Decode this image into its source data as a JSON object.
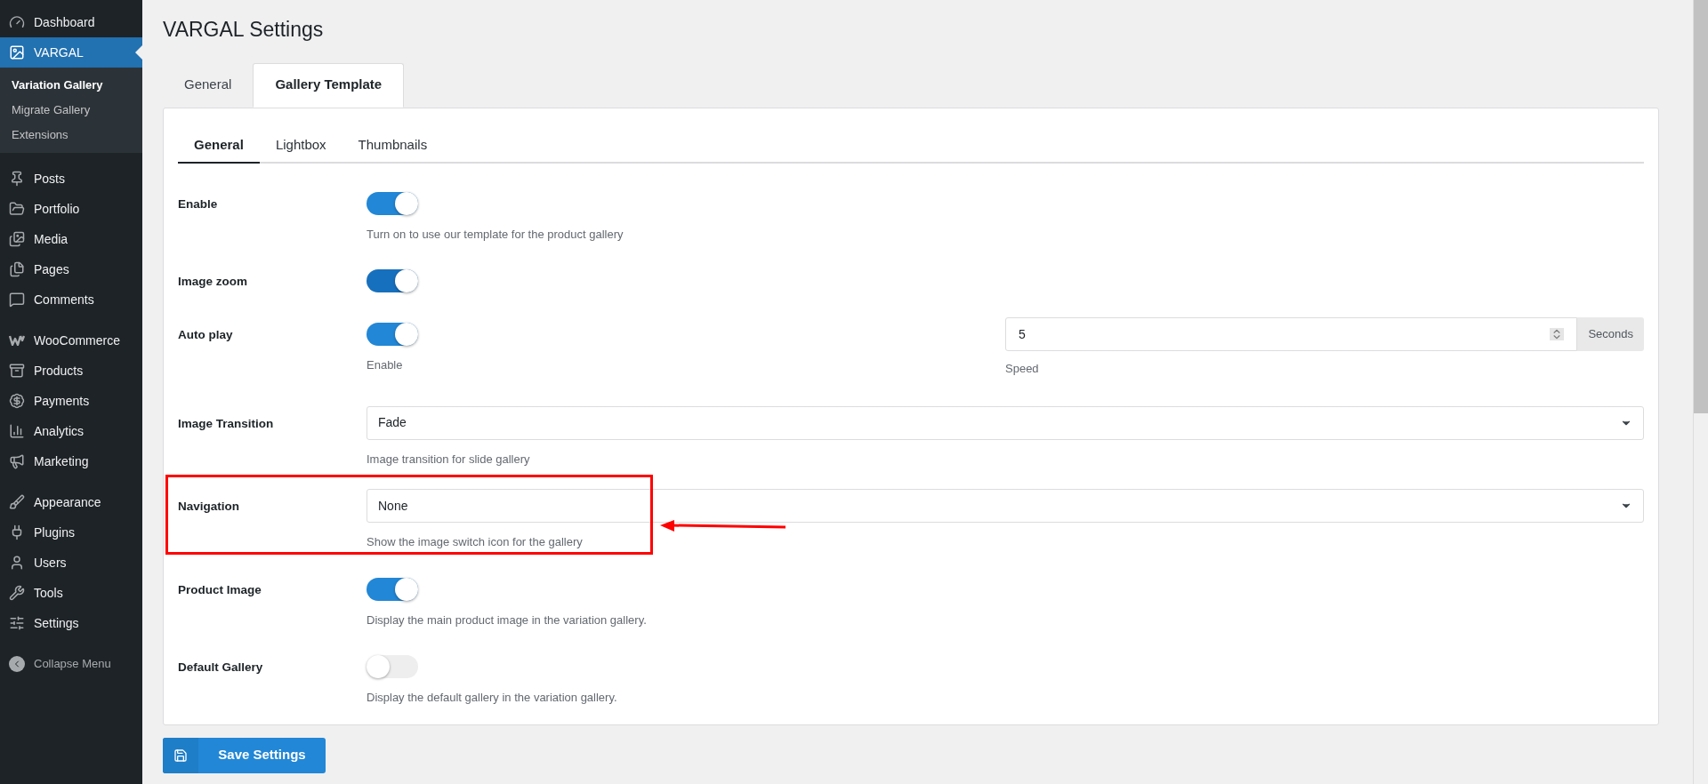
{
  "sidebar": {
    "groups": [
      [
        {
          "label": "Dashboard",
          "selected": false
        },
        {
          "label": "VARGAL",
          "selected": true,
          "submenu": [
            {
              "label": "Variation Gallery",
              "selected": true
            },
            {
              "label": "Migrate Gallery",
              "selected": false
            },
            {
              "label": "Extensions",
              "selected": false
            }
          ]
        }
      ],
      [
        {
          "label": "Posts",
          "selected": false
        },
        {
          "label": "Portfolio",
          "selected": false
        },
        {
          "label": "Media",
          "selected": false
        },
        {
          "label": "Pages",
          "selected": false
        },
        {
          "label": "Comments",
          "selected": false
        }
      ],
      [
        {
          "label": "WooCommerce",
          "selected": false
        },
        {
          "label": "Products",
          "selected": false
        },
        {
          "label": "Payments",
          "selected": false
        },
        {
          "label": "Analytics",
          "selected": false
        },
        {
          "label": "Marketing",
          "selected": false
        }
      ],
      [
        {
          "label": "Appearance",
          "selected": false
        },
        {
          "label": "Plugins",
          "selected": false
        },
        {
          "label": "Users",
          "selected": false
        },
        {
          "label": "Tools",
          "selected": false
        },
        {
          "label": "Settings",
          "selected": false
        }
      ]
    ],
    "collapse": "Collapse Menu"
  },
  "page_title": "VARGAL Settings",
  "tabs": [
    {
      "label": "General",
      "selected": false
    },
    {
      "label": "Gallery Template",
      "selected": true
    }
  ],
  "subtabs": [
    {
      "label": "General",
      "selected": true
    },
    {
      "label": "Lightbox",
      "selected": false
    },
    {
      "label": "Thumbnails",
      "selected": false
    }
  ],
  "settings": [
    {
      "kind": "toggle",
      "label": "Enable",
      "on": true,
      "description": "Turn on to use our template for the product gallery"
    },
    {
      "kind": "toggle",
      "label": "Image zoom",
      "on": true,
      "focused": true
    },
    {
      "kind": "toggle",
      "label": "Auto play",
      "on": true,
      "description": "Enable",
      "speed": {
        "value": "5",
        "unit": "Seconds",
        "caption": "Speed"
      }
    },
    {
      "kind": "select",
      "label": "Image Transition",
      "value": "Fade",
      "description": "Image transition for slide gallery"
    },
    {
      "kind": "select",
      "label": "Navigation",
      "value": "None",
      "description": "Show the image switch icon for the gallery",
      "highlighted": true
    },
    {
      "kind": "toggle",
      "label": "Product Image",
      "on": true,
      "description": "Display the main product image in the variation gallery."
    },
    {
      "kind": "toggle",
      "label": "Default Gallery",
      "on": false,
      "description": "Display the default gallery in the variation gallery."
    }
  ],
  "save_button": "Save Settings"
}
